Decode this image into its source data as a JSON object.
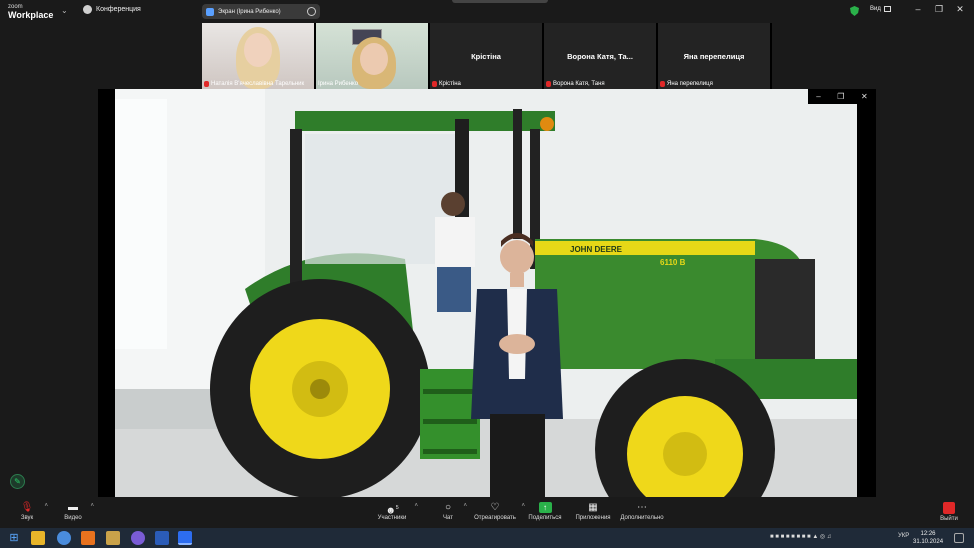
{
  "app": {
    "brand_line1": "zoom",
    "brand_line2": "Workplace"
  },
  "meeting": {
    "title": "Конференция"
  },
  "share_banner": {
    "label": "Экран (Ірина Рибенко)"
  },
  "view": {
    "label": "Вид"
  },
  "participants": [
    {
      "name": "Наталія В'ячеславівна Тарельник",
      "video": true
    },
    {
      "name": "Ірина Рибенко",
      "video": true,
      "active": true
    },
    {
      "name": "Крістіна",
      "display": "Крістіна",
      "video": false
    },
    {
      "name": "Ворона Катя, Таня",
      "display": "Ворона Катя, Та...",
      "video": false
    },
    {
      "name": "Яна перепелиця",
      "display": "Яна перепелиця",
      "video": false
    }
  ],
  "shared_content": {
    "tractor_brand": "JOHN DEERE",
    "tractor_model": "6110 B"
  },
  "toolbar": {
    "audio": "Звук",
    "video": "Видео",
    "participants": "Участники",
    "participants_count": "5",
    "chat": "Чат",
    "react": "Отреагировать",
    "share": "Поделиться",
    "apps": "Приложения",
    "more": "Дополнительно",
    "leave": "Выйти"
  },
  "taskbar": {
    "lang": "УКР",
    "time": "12:26",
    "date": "31.10.2024"
  },
  "colors": {
    "active_tile_border": "#2ccf6a",
    "muted_mic": "#e02828",
    "share_green": "#2ab14a",
    "tractor_green": "#3a8a2e",
    "tractor_yellow": "#f1e020"
  }
}
